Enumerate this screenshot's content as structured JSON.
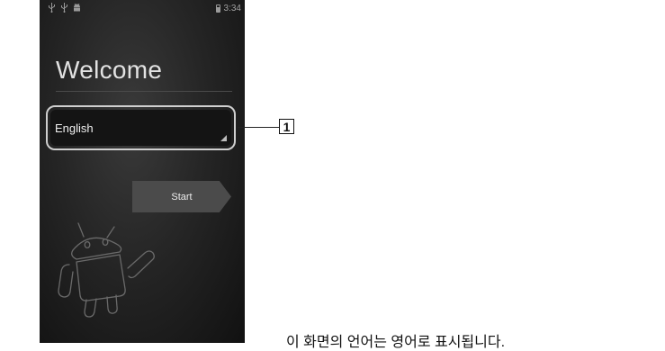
{
  "status_bar": {
    "icons": [
      "usb-icon",
      "usb-icon",
      "android-debug-icon",
      "battery-icon"
    ],
    "time": "3:34"
  },
  "setup": {
    "title": "Welcome",
    "language_value": "English",
    "start_label": "Start"
  },
  "annotation": {
    "callout_number": "1",
    "caption": "이 화면의 언어는 영어로 표시됩니다."
  }
}
